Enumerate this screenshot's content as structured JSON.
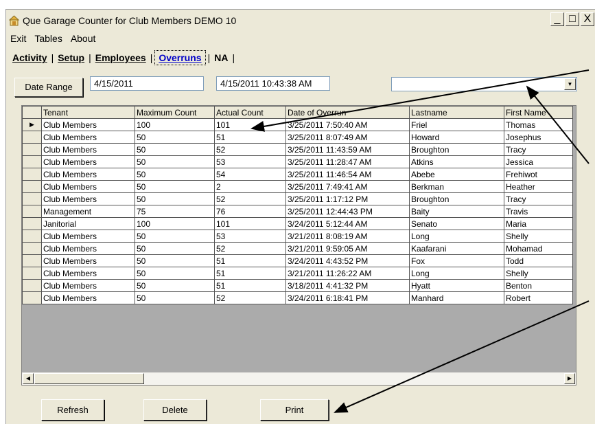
{
  "window": {
    "title": "Que Garage Counter for Club Members DEMO  10",
    "min": "_",
    "max": "□",
    "close": "X"
  },
  "menu": [
    "Exit",
    "Tables",
    "About"
  ],
  "tabs": [
    {
      "label": "Activity",
      "active": false
    },
    {
      "label": "Setup",
      "active": false
    },
    {
      "label": "Employees",
      "active": false
    },
    {
      "label": "Overruns",
      "active": true
    },
    {
      "label": "NA",
      "active": false
    }
  ],
  "filter": {
    "date_range_label": "Date Range",
    "start_date": "4/15/2011",
    "end_date": "4/15/2011 10:43:38 AM",
    "combo_value": ""
  },
  "grid": {
    "columns": [
      "Tenant",
      "Maximum Count",
      "Actual Count",
      "Date of Overrun",
      "Lastname",
      "First Name"
    ],
    "rows": [
      [
        "Club Members",
        "100",
        "101",
        "3/25/2011 7:50:40 AM",
        "Friel",
        "Thomas"
      ],
      [
        "Club Members",
        "50",
        "51",
        "3/25/2011 8:07:49 AM",
        "Howard",
        "Josephus"
      ],
      [
        "Club Members",
        "50",
        "52",
        "3/25/2011 11:43:59 AM",
        "Broughton",
        "Tracy"
      ],
      [
        "Club Members",
        "50",
        "53",
        "3/25/2011 11:28:47 AM",
        "Atkins",
        "Jessica"
      ],
      [
        "Club Members",
        "50",
        "54",
        "3/25/2011 11:46:54 AM",
        "Abebe",
        "Frehiwot"
      ],
      [
        "Club Members",
        "50",
        "2",
        "3/25/2011 7:49:41 AM",
        "Berkman",
        "Heather"
      ],
      [
        "Club Members",
        "50",
        "52",
        "3/25/2011 1:17:12 PM",
        "Broughton",
        "Tracy"
      ],
      [
        "Management",
        "75",
        "76",
        "3/25/2011 12:44:43 PM",
        "Baity",
        "Travis"
      ],
      [
        "Janitorial",
        "100",
        "101",
        "3/24/2011 5:12:44 AM",
        "Senato",
        "Maria"
      ],
      [
        "Club Members",
        "50",
        "53",
        "3/21/2011 8:08:19 AM",
        "Long",
        "Shelly"
      ],
      [
        "Club Members",
        "50",
        "52",
        "3/21/2011 9:59:05 AM",
        "Kaafarani",
        "Mohamad"
      ],
      [
        "Club Members",
        "50",
        "51",
        "3/24/2011 4:43:52 PM",
        "Fox",
        "Todd"
      ],
      [
        "Club Members",
        "50",
        "51",
        "3/21/2011 11:26:22 AM",
        "Long",
        "Shelly"
      ],
      [
        "Club Members",
        "50",
        "51",
        "3/18/2011 4:41:32 PM",
        "Hyatt",
        "Benton"
      ],
      [
        "Club Members",
        "50",
        "52",
        "3/24/2011 6:18:41 PM",
        "Manhard",
        "Robert"
      ]
    ],
    "selected_row": 0
  },
  "buttons": {
    "refresh": "Refresh",
    "delete": "Delete",
    "print": "Print"
  },
  "icons": {
    "app": "garage-icon",
    "row_pointer": "▶",
    "scroll_left": "◀",
    "scroll_right": "▶",
    "combo": "▼"
  }
}
